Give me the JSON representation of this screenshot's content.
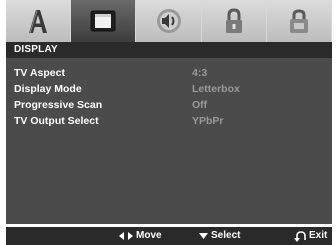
{
  "tabs": [
    {
      "icon": "language-a-icon",
      "active": false
    },
    {
      "icon": "display-screen-icon",
      "active": true
    },
    {
      "icon": "audio-speaker-icon",
      "active": false
    },
    {
      "icon": "lock-icon",
      "active": false
    },
    {
      "icon": "other-settings-icon",
      "active": false
    }
  ],
  "menu": {
    "title": "DISPLAY",
    "items": [
      {
        "label": "TV Aspect",
        "value": "4:3"
      },
      {
        "label": "Display Mode",
        "value": "Letterbox"
      },
      {
        "label": "Progressive Scan",
        "value": "Off"
      },
      {
        "label": "TV Output Select",
        "value": "YPbPr"
      }
    ]
  },
  "footer": {
    "move": "Move",
    "select": "Select",
    "exit": "Exit"
  },
  "colors": {
    "panel": "#4b4b4b",
    "header": "#2a2a2a",
    "label": "#ffffff",
    "value": "#9a9a9a",
    "tab_active": "#4a4a4a",
    "tab_inactive": "#cfcfcf"
  }
}
